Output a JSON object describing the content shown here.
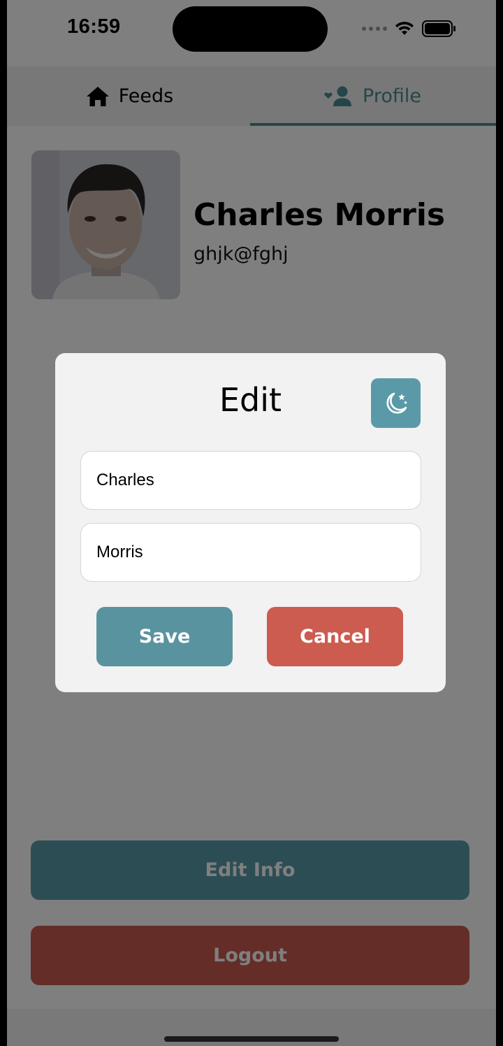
{
  "status_bar": {
    "time": "16:59"
  },
  "tabs": [
    {
      "label": "Feeds",
      "icon": "home-icon",
      "active": false
    },
    {
      "label": "Profile",
      "icon": "user-heart-icon",
      "active": true
    }
  ],
  "profile": {
    "name": "Charles Morris",
    "email": "ghjk@fghj"
  },
  "actions": {
    "edit_info_label": "Edit Info",
    "logout_label": "Logout"
  },
  "modal": {
    "title": "Edit",
    "theme_icon": "moon-stars-icon",
    "first_name_value": "Charles",
    "last_name_value": "Morris",
    "save_label": "Save",
    "cancel_label": "Cancel"
  },
  "colors": {
    "accent": "#5a9aa8",
    "danger": "#cc5b50",
    "tab_active": "#4b8a96"
  }
}
